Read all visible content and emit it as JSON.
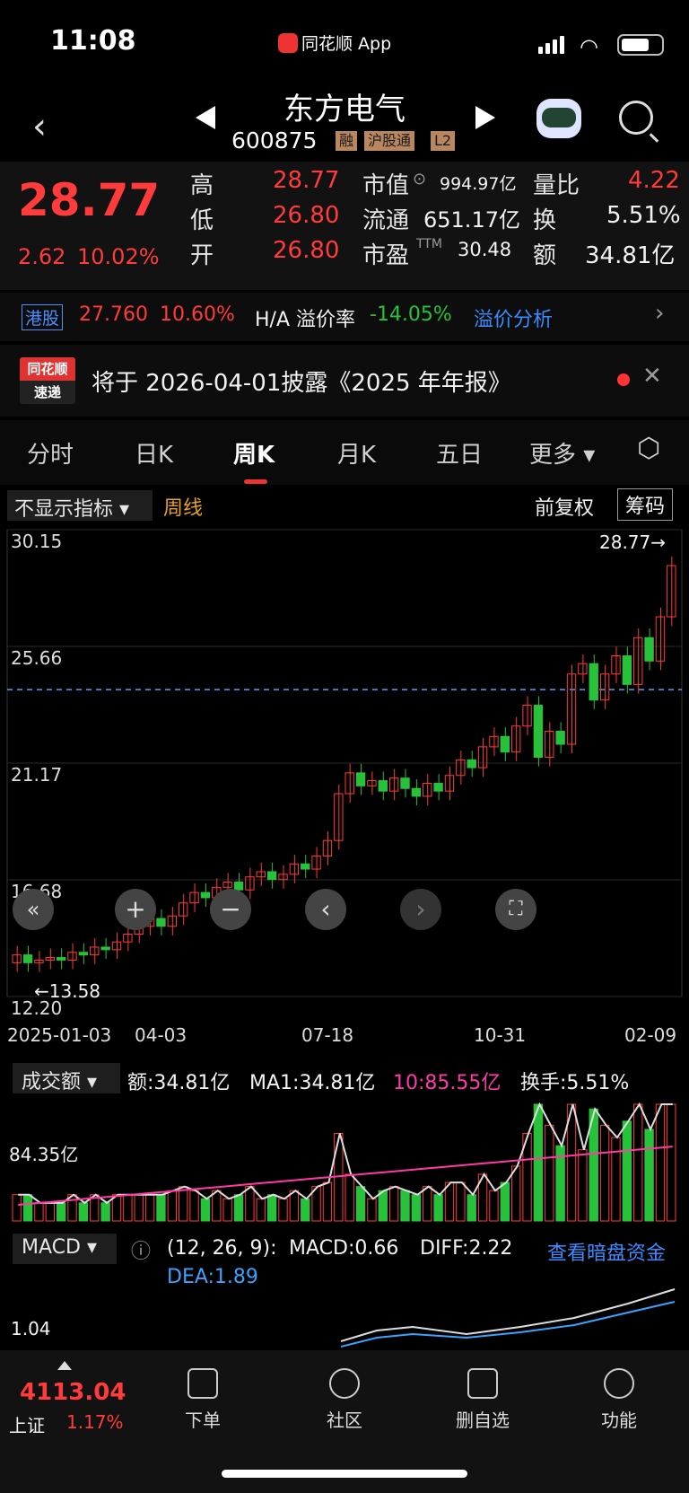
{
  "status_bar": {
    "time": "11:08",
    "app_name": "同花顺 App"
  },
  "header": {
    "stock_name": "东方电气",
    "stock_code": "600875",
    "tags": [
      "融",
      "沪股通",
      "L2"
    ]
  },
  "quote": {
    "price": "28.77",
    "change": "2.62",
    "change_pct": "10.02%",
    "high_label": "高",
    "high": "28.77",
    "low_label": "低",
    "low": "26.80",
    "open_label": "开",
    "open": "26.80",
    "mktcap_label": "市值",
    "mktcap": "994.97亿",
    "float_label": "流通",
    "float": "651.17亿",
    "pe_label": "市盈",
    "pe_ttm_tag": "TTM",
    "pe": "30.48",
    "vol_ratio_label": "量比",
    "vol_ratio": "4.22",
    "turnover_label": "换",
    "turnover": "5.51%",
    "amount_label": "额",
    "amount": "34.81亿"
  },
  "hk": {
    "tag": "港股",
    "price": "27.760",
    "pct": "10.60%",
    "premium_label": "H/A 溢价率",
    "premium": "-14.05%",
    "link": "溢价分析"
  },
  "notice": {
    "logo_top": "同花顺",
    "logo_bottom": "速递",
    "text": "将于 2026-04-01披露《2025 年年报》"
  },
  "tabs": [
    "分时",
    "日K",
    "周K",
    "月K",
    "五日",
    "更多"
  ],
  "chart_toolbar": {
    "indicator": "不显示指标",
    "period": "周线",
    "adjust": "前复权",
    "chips": "筹码"
  },
  "chart_data": {
    "type": "candlestick",
    "title": "周线",
    "y_ticks": [
      "30.15",
      "25.66",
      "21.17",
      "16.68",
      "12.20"
    ],
    "x_ticks": [
      "2025-01-03",
      "04-03",
      "07-18",
      "10-31",
      "02-09"
    ],
    "ylim": [
      12.2,
      30.15
    ],
    "high_marker": "28.77",
    "low_marker": "13.58",
    "reference_line": 24.0,
    "weekly_close": [
      13.8,
      13.5,
      13.6,
      13.7,
      13.6,
      13.9,
      13.8,
      14.1,
      14.0,
      14.3,
      14.6,
      14.9,
      15.2,
      14.9,
      15.3,
      15.8,
      16.2,
      16.0,
      16.4,
      16.6,
      16.3,
      16.8,
      17.0,
      16.7,
      16.9,
      17.3,
      17.1,
      17.6,
      18.2,
      20.0,
      20.8,
      20.3,
      20.5,
      20.1,
      20.6,
      20.2,
      19.9,
      20.4,
      20.1,
      20.7,
      21.3,
      21.0,
      21.8,
      22.2,
      21.6,
      22.6,
      23.4,
      21.4,
      22.4,
      21.9,
      24.6,
      25.0,
      23.6,
      24.6,
      25.3,
      24.2,
      26.0,
      25.1,
      26.8,
      28.77
    ]
  },
  "volume_panel": {
    "indicator": "成交额",
    "amount": "额:34.81亿",
    "ma1": "MA1:34.81亿",
    "ma10": "10:85.55亿",
    "turnover": "换手:5.51%",
    "y_tick": "84.35亿"
  },
  "macd_panel": {
    "indicator": "MACD",
    "params": "(12, 26, 9):",
    "macd": "MACD:0.66",
    "diff": "DIFF:2.22",
    "dea": "DEA:1.89",
    "link": "查看暗盘资金",
    "y_tick": "1.04"
  },
  "index": {
    "value": "4113.04",
    "name": "上证",
    "pct": "1.17%"
  },
  "bottom_nav": [
    "下单",
    "社区",
    "删自选",
    "功能"
  ]
}
